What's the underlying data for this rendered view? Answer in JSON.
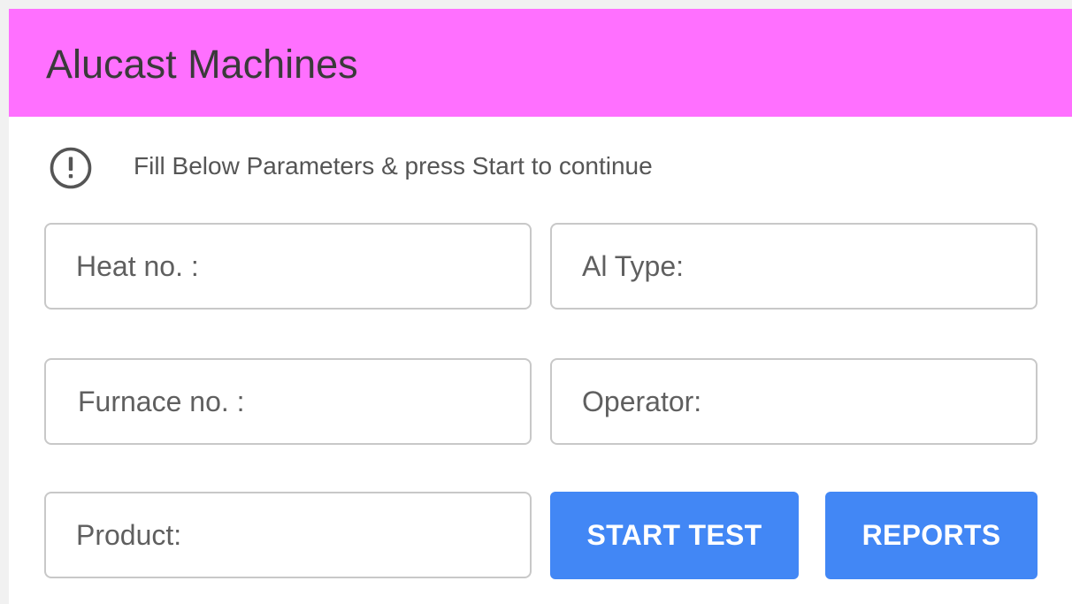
{
  "header": {
    "title": "Alucast Machines",
    "background": "#ff70ff"
  },
  "notice": {
    "icon": "info-circle-icon",
    "text": "Fill Below Parameters & press Start to continue"
  },
  "form": {
    "heat_no": {
      "placeholder": "Heat no. :",
      "value": ""
    },
    "al_type": {
      "placeholder": "Al Type:",
      "value": ""
    },
    "furnace_no": {
      "placeholder": "Furnace no. :",
      "value": ""
    },
    "operator": {
      "placeholder": "Operator:",
      "value": ""
    },
    "product": {
      "placeholder": "Product:",
      "value": ""
    }
  },
  "actions": {
    "start_label": "START TEST",
    "reports_label": "REPORTS",
    "accent": "#4287f5"
  }
}
